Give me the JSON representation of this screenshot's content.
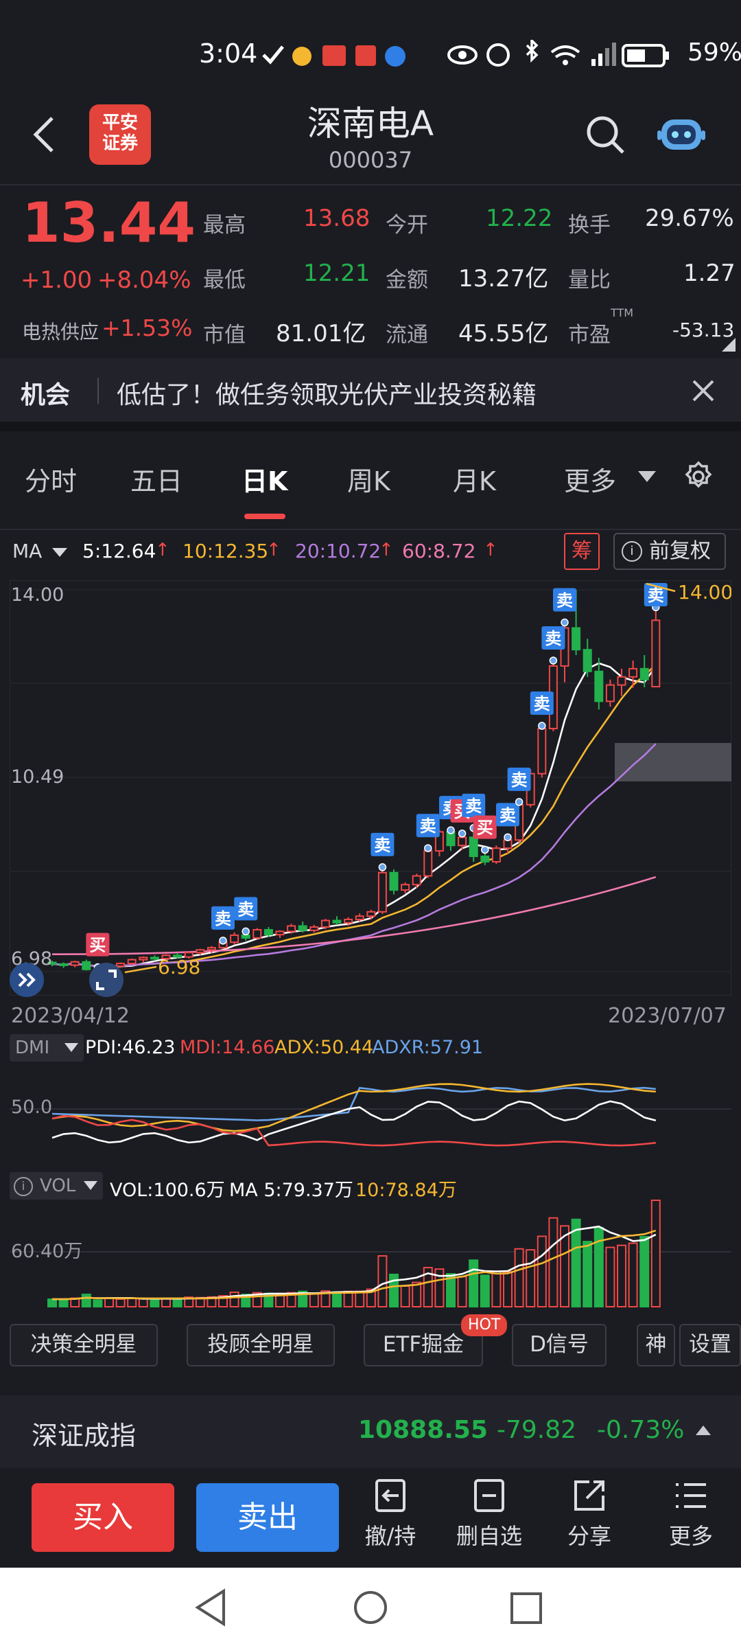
{
  "status_bar": {
    "time": "3:04",
    "battery": "59%"
  },
  "header": {
    "logo_line1": "平安",
    "logo_line2": "证券",
    "stock_name": "深南电A",
    "stock_code": "000037"
  },
  "quote": {
    "price": "13.44",
    "change": "+1.00",
    "change_pct": "+8.04%",
    "sector": "电热供应",
    "sector_pct": "+1.53%",
    "stats": [
      {
        "label": "最高",
        "value": "13.68"
      },
      {
        "label": "今开",
        "value": "12.22"
      },
      {
        "label": "换手",
        "value": "29.67%"
      },
      {
        "label": "最低",
        "value": "12.21"
      },
      {
        "label": "金额",
        "value": "13.27亿"
      },
      {
        "label": "量比",
        "value": "1.27"
      },
      {
        "label": "市值",
        "value": "81.01亿"
      },
      {
        "label": "流通",
        "value": "45.55亿"
      },
      {
        "label": "市盈",
        "value": "-53.13",
        "sup": "TTM"
      }
    ]
  },
  "banner": {
    "tag": "机会",
    "text": "低估了！做任务领取光伏产业投资秘籍"
  },
  "tabs": [
    "分时",
    "五日",
    "日K",
    "周K",
    "月K",
    "更多"
  ],
  "active_tab": "日K",
  "ma_row": {
    "label": "MA",
    "ma5": "5:12.64",
    "ma10": "10:12.35",
    "ma20": "20:10.72",
    "ma60": "60:8.72",
    "chip": "筹",
    "adjust": "前复权"
  },
  "colors": {
    "red": "#f04848",
    "green": "#22b14c",
    "ma5": "#ffffff",
    "ma10": "#f5b730",
    "ma20": "#b57be0",
    "ma60": "#f07ab0",
    "blue": "#2f7fe6"
  },
  "price_axis": {
    "top": "14.00",
    "mid": "10.49",
    "bottom": "6.98"
  },
  "price_marks": {
    "high": "14.00",
    "low": "6.98"
  },
  "signals": {
    "buy": "买",
    "sell": "卖"
  },
  "dates": {
    "start": "2023/04/12",
    "end": "2023/07/07"
  },
  "dmi": {
    "label": "DMI",
    "pdi": "PDI:46.23",
    "mdi": "MDI:14.66",
    "adx": "ADX:50.44",
    "adxr": "ADXR:57.91",
    "level": "50.0"
  },
  "vol": {
    "label": "VOL",
    "vol": "VOL:100.6万",
    "ma5": "MA 5:79.37万",
    "ma10": "10:78.84万",
    "level": "60.40万"
  },
  "pills": [
    "决策全明星",
    "投顾全明星",
    "ETF掘金",
    "D信号",
    "神",
    "设置"
  ],
  "hot_badge": "HOT",
  "index_bar": {
    "name": "深证成指",
    "value": "10888.55",
    "change": "-79.82",
    "pct": "-0.73%"
  },
  "bottom": {
    "buy": "买入",
    "sell": "卖出",
    "tools": [
      "撤/持",
      "删自选",
      "分享",
      "更多"
    ]
  },
  "chart_data": {
    "type": "candlestick",
    "x_range": [
      "2023/04/12",
      "2023/07/07"
    ],
    "ylim": [
      6.98,
      14.0
    ],
    "ohlc": [
      [
        7.15,
        7.18,
        7.08,
        7.12
      ],
      [
        7.12,
        7.15,
        7.05,
        7.1
      ],
      [
        7.1,
        7.18,
        7.06,
        7.16
      ],
      [
        7.16,
        7.2,
        7.0,
        7.02
      ],
      [
        7.02,
        7.06,
        6.98,
        7.0
      ],
      [
        7.0,
        7.1,
        6.98,
        7.08
      ],
      [
        7.08,
        7.15,
        7.05,
        7.13
      ],
      [
        7.13,
        7.22,
        7.1,
        7.2
      ],
      [
        7.2,
        7.26,
        7.15,
        7.24
      ],
      [
        7.24,
        7.28,
        7.18,
        7.22
      ],
      [
        7.22,
        7.3,
        7.2,
        7.28
      ],
      [
        7.28,
        7.32,
        7.22,
        7.25
      ],
      [
        7.25,
        7.35,
        7.22,
        7.33
      ],
      [
        7.33,
        7.4,
        7.28,
        7.38
      ],
      [
        7.38,
        7.45,
        7.32,
        7.42
      ],
      [
        7.42,
        7.55,
        7.4,
        7.52
      ],
      [
        7.52,
        7.7,
        7.48,
        7.65
      ],
      [
        7.65,
        7.72,
        7.55,
        7.6
      ],
      [
        7.6,
        7.78,
        7.58,
        7.75
      ],
      [
        7.75,
        7.8,
        7.62,
        7.66
      ],
      [
        7.66,
        7.74,
        7.6,
        7.72
      ],
      [
        7.72,
        7.86,
        7.68,
        7.82
      ],
      [
        7.82,
        7.9,
        7.7,
        7.74
      ],
      [
        7.74,
        7.84,
        7.7,
        7.8
      ],
      [
        7.8,
        7.95,
        7.76,
        7.92
      ],
      [
        7.92,
        8.0,
        7.84,
        7.88
      ],
      [
        7.88,
        7.98,
        7.82,
        7.94
      ],
      [
        7.94,
        8.05,
        7.9,
        8.0
      ],
      [
        8.0,
        8.12,
        7.94,
        8.08
      ],
      [
        8.08,
        8.9,
        8.04,
        8.8
      ],
      [
        8.8,
        8.86,
        8.4,
        8.48
      ],
      [
        8.48,
        8.62,
        8.42,
        8.58
      ],
      [
        8.58,
        8.78,
        8.52,
        8.74
      ],
      [
        8.74,
        9.25,
        8.7,
        9.2
      ],
      [
        9.2,
        9.6,
        9.1,
        9.55
      ],
      [
        9.55,
        9.58,
        9.2,
        9.3
      ],
      [
        9.3,
        9.52,
        9.22,
        9.45
      ],
      [
        9.45,
        9.62,
        9.0,
        9.1
      ],
      [
        9.1,
        9.22,
        8.94,
        9.0
      ],
      [
        9.0,
        9.3,
        8.96,
        9.25
      ],
      [
        9.25,
        9.45,
        9.15,
        9.4
      ],
      [
        9.4,
        10.1,
        9.35,
        10.05
      ],
      [
        10.05,
        10.7,
        10.0,
        10.62
      ],
      [
        10.62,
        11.5,
        10.55,
        11.45
      ],
      [
        11.45,
        12.7,
        11.4,
        12.6
      ],
      [
        12.6,
        13.4,
        12.3,
        13.3
      ],
      [
        13.3,
        14.0,
        12.8,
        12.9
      ],
      [
        12.9,
        13.1,
        12.4,
        12.5
      ],
      [
        12.5,
        12.75,
        11.8,
        11.95
      ],
      [
        11.95,
        12.35,
        11.85,
        12.25
      ],
      [
        12.25,
        12.55,
        12.05,
        12.4
      ],
      [
        12.4,
        12.7,
        12.2,
        12.55
      ],
      [
        12.55,
        12.8,
        12.21,
        12.35
      ],
      [
        12.22,
        13.68,
        12.21,
        13.44
      ]
    ]
  }
}
